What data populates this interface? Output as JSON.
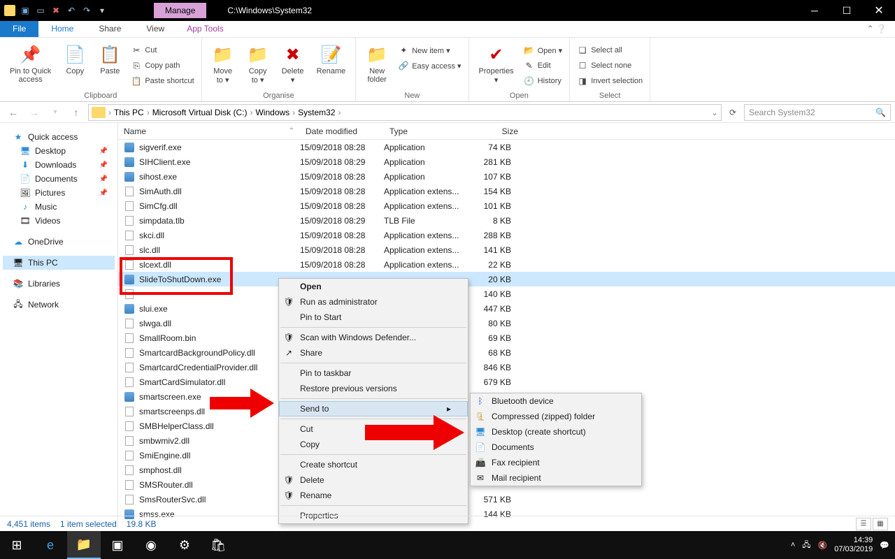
{
  "titlebar": {
    "manage": "Manage",
    "path": "C:\\Windows\\System32"
  },
  "tabs": {
    "file": "File",
    "home": "Home",
    "share": "Share",
    "view": "View",
    "apptools": "App Tools"
  },
  "ribbon": {
    "clipboard": {
      "pin": "Pin to Quick\naccess",
      "copy": "Copy",
      "paste": "Paste",
      "cut": "Cut",
      "copypath": "Copy path",
      "pasteshort": "Paste shortcut",
      "label": "Clipboard"
    },
    "organise": {
      "moveto": "Move\nto ▾",
      "copyto": "Copy\nto ▾",
      "delete": "Delete\n▾",
      "rename": "Rename",
      "label": "Organise"
    },
    "new": {
      "newfolder": "New\nfolder",
      "newitem": "New item ▾",
      "easy": "Easy access ▾",
      "label": "New"
    },
    "open": {
      "properties": "Properties\n▾",
      "open": "Open ▾",
      "edit": "Edit",
      "history": "History",
      "label": "Open"
    },
    "select": {
      "all": "Select all",
      "none": "Select none",
      "invert": "Invert selection",
      "label": "Select"
    }
  },
  "crumbs": [
    "This PC",
    "Microsoft Virtual Disk (C:)",
    "Windows",
    "System32"
  ],
  "search_placeholder": "Search System32",
  "sidebar": {
    "quick": "Quick access",
    "desktop": "Desktop",
    "downloads": "Downloads",
    "documents": "Documents",
    "pictures": "Pictures",
    "music": "Music",
    "videos": "Videos",
    "onedrive": "OneDrive",
    "thispc": "This PC",
    "libraries": "Libraries",
    "network": "Network"
  },
  "columns": {
    "name": "Name",
    "date": "Date modified",
    "type": "Type",
    "size": "Size"
  },
  "files": [
    {
      "n": "sigverif.exe",
      "d": "15/09/2018 08:28",
      "t": "Application",
      "s": "74 KB",
      "k": "exe"
    },
    {
      "n": "SIHClient.exe",
      "d": "15/09/2018 08:29",
      "t": "Application",
      "s": "281 KB",
      "k": "exe"
    },
    {
      "n": "sihost.exe",
      "d": "15/09/2018 08:28",
      "t": "Application",
      "s": "107 KB",
      "k": "exe"
    },
    {
      "n": "SimAuth.dll",
      "d": "15/09/2018 08:28",
      "t": "Application extens...",
      "s": "154 KB",
      "k": "dll"
    },
    {
      "n": "SimCfg.dll",
      "d": "15/09/2018 08:28",
      "t": "Application extens...",
      "s": "101 KB",
      "k": "dll"
    },
    {
      "n": "simpdata.tlb",
      "d": "15/09/2018 08:29",
      "t": "TLB File",
      "s": "8 KB",
      "k": "bin"
    },
    {
      "n": "skci.dll",
      "d": "15/09/2018 08:28",
      "t": "Application extens...",
      "s": "288 KB",
      "k": "dll"
    },
    {
      "n": "slc.dll",
      "d": "15/09/2018 08:28",
      "t": "Application extens...",
      "s": "141 KB",
      "k": "dll"
    },
    {
      "n": "slcext.dll",
      "d": "15/09/2018 08:28",
      "t": "Application extens...",
      "s": "22 KB",
      "k": "dll"
    },
    {
      "n": "SlideToShutDown.exe",
      "d": "",
      "t": "",
      "s": "20 KB",
      "k": "exe",
      "sel": true
    },
    {
      "n": "",
      "d": "",
      "t": "",
      "s": "140 KB",
      "k": "dll"
    },
    {
      "n": "slui.exe",
      "d": "",
      "t": "",
      "s": "447 KB",
      "k": "exe"
    },
    {
      "n": "slwga.dll",
      "d": "",
      "t": "",
      "s": "80 KB",
      "k": "dll"
    },
    {
      "n": "SmallRoom.bin",
      "d": "",
      "t": "",
      "s": "69 KB",
      "k": "bin"
    },
    {
      "n": "SmartcardBackgroundPolicy.dll",
      "d": "",
      "t": "",
      "s": "68 KB",
      "k": "dll"
    },
    {
      "n": "SmartcardCredentialProvider.dll",
      "d": "",
      "t": "",
      "s": "846 KB",
      "k": "dll"
    },
    {
      "n": "SmartCardSimulator.dll",
      "d": "",
      "t": "",
      "s": "679 KB",
      "k": "dll"
    },
    {
      "n": "smartscreen.exe",
      "d": "",
      "t": "",
      "s": "",
      "k": "exe"
    },
    {
      "n": "smartscreenps.dll",
      "d": "",
      "t": "",
      "s": "",
      "k": "dll"
    },
    {
      "n": "SMBHelperClass.dll",
      "d": "",
      "t": "",
      "s": "",
      "k": "dll"
    },
    {
      "n": "smbwmiv2.dll",
      "d": "",
      "t": "",
      "s": "",
      "k": "dll"
    },
    {
      "n": "SmiEngine.dll",
      "d": "",
      "t": "",
      "s": "",
      "k": "dll"
    },
    {
      "n": "smphost.dll",
      "d": "",
      "t": "",
      "s": "",
      "k": "dll"
    },
    {
      "n": "SMSRouter.dll",
      "d": "",
      "t": "",
      "s": "",
      "k": "dll"
    },
    {
      "n": "SmsRouterSvc.dll",
      "d": "",
      "t": "",
      "s": "571 KB",
      "k": "dll"
    },
    {
      "n": "smss.exe",
      "d": "",
      "t": "",
      "s": "144 KB",
      "k": "exe"
    }
  ],
  "ctx1": {
    "open": "Open",
    "runas": "Run as administrator",
    "pinstart": "Pin to Start",
    "scan": "Scan with Windows Defender...",
    "share": "Share",
    "pintask": "Pin to taskbar",
    "restore": "Restore previous versions",
    "sendto": "Send to",
    "cut": "Cut",
    "copy": "Copy",
    "shortcut": "Create shortcut",
    "delete": "Delete",
    "rename": "Rename",
    "props": "Properties"
  },
  "ctx2": {
    "bt": "Bluetooth device",
    "zip": "Compressed (zipped) folder",
    "desk": "Desktop (create shortcut)",
    "docs": "Documents",
    "fax": "Fax recipient",
    "mail": "Mail recipient"
  },
  "status": {
    "items": "4,451 items",
    "sel": "1 item selected",
    "size": "19.8 KB"
  },
  "clock": {
    "time": "14:39",
    "date": "07/03/2019"
  }
}
